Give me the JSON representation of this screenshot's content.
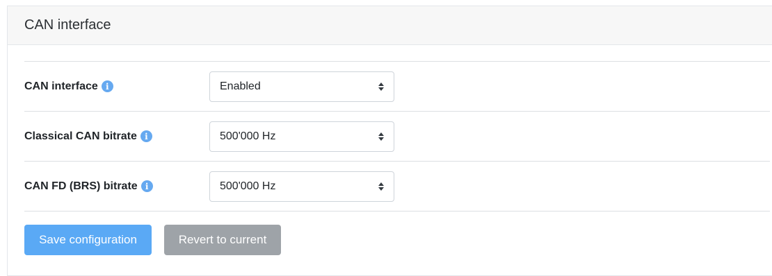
{
  "panel": {
    "title": "CAN interface"
  },
  "rows": [
    {
      "label": "CAN interface",
      "icon": "info-icon",
      "value": "Enabled"
    },
    {
      "label": "Classical CAN bitrate",
      "icon": "info-icon",
      "value": "500'000 Hz"
    },
    {
      "label": "CAN FD (BRS) bitrate",
      "icon": "info-icon",
      "value": "500'000 Hz"
    }
  ],
  "info_glyph": "i",
  "actions": {
    "save_label": "Save configuration",
    "revert_label": "Revert to current"
  },
  "colors": {
    "save_button": "#5aa9f5",
    "revert_button": "#9ea3a8",
    "info_icon": "#66a9f0",
    "header_background": "#f7f7f7"
  }
}
